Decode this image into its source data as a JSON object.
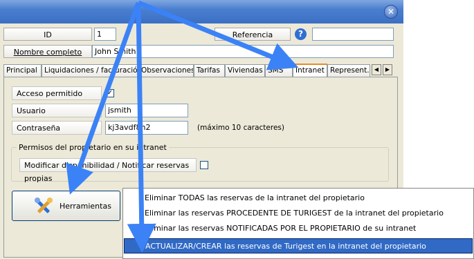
{
  "form": {
    "id_label": "ID",
    "id_value": "1",
    "referencia_label": "Referencia",
    "referencia_value": "",
    "nombre_label": "Nombre completo",
    "nombre_value": "John Smith"
  },
  "tabs": [
    {
      "label": "Principal"
    },
    {
      "label": "Liquidaciones / facturación"
    },
    {
      "label": "Observaciones"
    },
    {
      "label": "Tarifas"
    },
    {
      "label": "Viviendas"
    },
    {
      "label": "SMS"
    },
    {
      "label": "Intranet",
      "active": true
    },
    {
      "label": "Represent. l"
    }
  ],
  "intranet": {
    "acceso_label": "Acceso permitido",
    "acceso_checked": true,
    "usuario_label": "Usuario",
    "usuario_value": "jsmith",
    "contrasena_label": "Contraseña",
    "contrasena_value": "kj3avdf8h2",
    "contrasena_hint": "(máximo 10 caracteres)",
    "permisos_title": "Permisos del propietario en su intranet",
    "modificar_label": "Modificar disponibilidad / Notificar reservas propias",
    "modificar_checked": false
  },
  "tools": {
    "button_label": "Herramientas",
    "icon": "tools-icon"
  },
  "menu": {
    "items": [
      {
        "label": "Eliminar TODAS las reservas de la intranet del propietario",
        "highlighted": false
      },
      {
        "label": "Eliminar las reservas PROCEDENTE DE TURIGEST de la intranet del propietario",
        "highlighted": false
      },
      {
        "label": "Eliminar las reservas NOTIFICADAS POR EL PROPIETARIO de su intranet",
        "highlighted": false
      },
      {
        "label": "ACTUALIZAR/CREAR las reservas de Turigest en la intranet del propietario",
        "highlighted": true
      }
    ]
  },
  "colors": {
    "accent": "#316ac5",
    "titlebar": "#3a6fc4",
    "window_bg": "#ece9d8",
    "annotation_arrow": "#3b82f6"
  }
}
